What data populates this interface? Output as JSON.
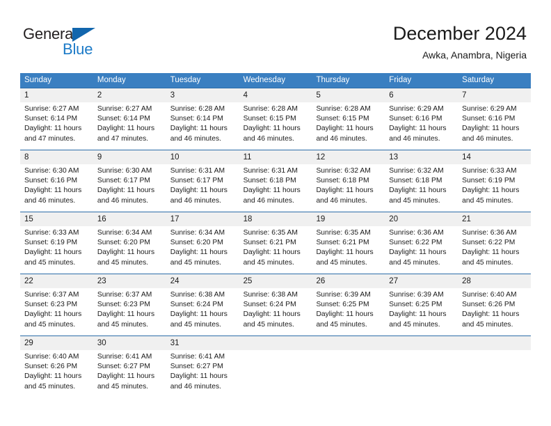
{
  "brand": {
    "name_part1": "General",
    "name_part2": "Blue",
    "accent_color": "#1b7ac7",
    "triangle_color": "#1266ad"
  },
  "header": {
    "title": "December 2024",
    "subtitle": "Awka, Anambra, Nigeria"
  },
  "theme": {
    "header_bg": "#3a7fc1",
    "row_divider": "#2b6ca8",
    "daynum_bg": "#f0f0f0"
  },
  "weekdays": [
    "Sunday",
    "Monday",
    "Tuesday",
    "Wednesday",
    "Thursday",
    "Friday",
    "Saturday"
  ],
  "weeks": [
    [
      {
        "day": "1",
        "sunrise": "Sunrise: 6:27 AM",
        "sunset": "Sunset: 6:14 PM",
        "daylight_line1": "Daylight: 11 hours",
        "daylight_line2": "and 47 minutes."
      },
      {
        "day": "2",
        "sunrise": "Sunrise: 6:27 AM",
        "sunset": "Sunset: 6:14 PM",
        "daylight_line1": "Daylight: 11 hours",
        "daylight_line2": "and 47 minutes."
      },
      {
        "day": "3",
        "sunrise": "Sunrise: 6:28 AM",
        "sunset": "Sunset: 6:14 PM",
        "daylight_line1": "Daylight: 11 hours",
        "daylight_line2": "and 46 minutes."
      },
      {
        "day": "4",
        "sunrise": "Sunrise: 6:28 AM",
        "sunset": "Sunset: 6:15 PM",
        "daylight_line1": "Daylight: 11 hours",
        "daylight_line2": "and 46 minutes."
      },
      {
        "day": "5",
        "sunrise": "Sunrise: 6:28 AM",
        "sunset": "Sunset: 6:15 PM",
        "daylight_line1": "Daylight: 11 hours",
        "daylight_line2": "and 46 minutes."
      },
      {
        "day": "6",
        "sunrise": "Sunrise: 6:29 AM",
        "sunset": "Sunset: 6:16 PM",
        "daylight_line1": "Daylight: 11 hours",
        "daylight_line2": "and 46 minutes."
      },
      {
        "day": "7",
        "sunrise": "Sunrise: 6:29 AM",
        "sunset": "Sunset: 6:16 PM",
        "daylight_line1": "Daylight: 11 hours",
        "daylight_line2": "and 46 minutes."
      }
    ],
    [
      {
        "day": "8",
        "sunrise": "Sunrise: 6:30 AM",
        "sunset": "Sunset: 6:16 PM",
        "daylight_line1": "Daylight: 11 hours",
        "daylight_line2": "and 46 minutes."
      },
      {
        "day": "9",
        "sunrise": "Sunrise: 6:30 AM",
        "sunset": "Sunset: 6:17 PM",
        "daylight_line1": "Daylight: 11 hours",
        "daylight_line2": "and 46 minutes."
      },
      {
        "day": "10",
        "sunrise": "Sunrise: 6:31 AM",
        "sunset": "Sunset: 6:17 PM",
        "daylight_line1": "Daylight: 11 hours",
        "daylight_line2": "and 46 minutes."
      },
      {
        "day": "11",
        "sunrise": "Sunrise: 6:31 AM",
        "sunset": "Sunset: 6:18 PM",
        "daylight_line1": "Daylight: 11 hours",
        "daylight_line2": "and 46 minutes."
      },
      {
        "day": "12",
        "sunrise": "Sunrise: 6:32 AM",
        "sunset": "Sunset: 6:18 PM",
        "daylight_line1": "Daylight: 11 hours",
        "daylight_line2": "and 46 minutes."
      },
      {
        "day": "13",
        "sunrise": "Sunrise: 6:32 AM",
        "sunset": "Sunset: 6:18 PM",
        "daylight_line1": "Daylight: 11 hours",
        "daylight_line2": "and 45 minutes."
      },
      {
        "day": "14",
        "sunrise": "Sunrise: 6:33 AM",
        "sunset": "Sunset: 6:19 PM",
        "daylight_line1": "Daylight: 11 hours",
        "daylight_line2": "and 45 minutes."
      }
    ],
    [
      {
        "day": "15",
        "sunrise": "Sunrise: 6:33 AM",
        "sunset": "Sunset: 6:19 PM",
        "daylight_line1": "Daylight: 11 hours",
        "daylight_line2": "and 45 minutes."
      },
      {
        "day": "16",
        "sunrise": "Sunrise: 6:34 AM",
        "sunset": "Sunset: 6:20 PM",
        "daylight_line1": "Daylight: 11 hours",
        "daylight_line2": "and 45 minutes."
      },
      {
        "day": "17",
        "sunrise": "Sunrise: 6:34 AM",
        "sunset": "Sunset: 6:20 PM",
        "daylight_line1": "Daylight: 11 hours",
        "daylight_line2": "and 45 minutes."
      },
      {
        "day": "18",
        "sunrise": "Sunrise: 6:35 AM",
        "sunset": "Sunset: 6:21 PM",
        "daylight_line1": "Daylight: 11 hours",
        "daylight_line2": "and 45 minutes."
      },
      {
        "day": "19",
        "sunrise": "Sunrise: 6:35 AM",
        "sunset": "Sunset: 6:21 PM",
        "daylight_line1": "Daylight: 11 hours",
        "daylight_line2": "and 45 minutes."
      },
      {
        "day": "20",
        "sunrise": "Sunrise: 6:36 AM",
        "sunset": "Sunset: 6:22 PM",
        "daylight_line1": "Daylight: 11 hours",
        "daylight_line2": "and 45 minutes."
      },
      {
        "day": "21",
        "sunrise": "Sunrise: 6:36 AM",
        "sunset": "Sunset: 6:22 PM",
        "daylight_line1": "Daylight: 11 hours",
        "daylight_line2": "and 45 minutes."
      }
    ],
    [
      {
        "day": "22",
        "sunrise": "Sunrise: 6:37 AM",
        "sunset": "Sunset: 6:23 PM",
        "daylight_line1": "Daylight: 11 hours",
        "daylight_line2": "and 45 minutes."
      },
      {
        "day": "23",
        "sunrise": "Sunrise: 6:37 AM",
        "sunset": "Sunset: 6:23 PM",
        "daylight_line1": "Daylight: 11 hours",
        "daylight_line2": "and 45 minutes."
      },
      {
        "day": "24",
        "sunrise": "Sunrise: 6:38 AM",
        "sunset": "Sunset: 6:24 PM",
        "daylight_line1": "Daylight: 11 hours",
        "daylight_line2": "and 45 minutes."
      },
      {
        "day": "25",
        "sunrise": "Sunrise: 6:38 AM",
        "sunset": "Sunset: 6:24 PM",
        "daylight_line1": "Daylight: 11 hours",
        "daylight_line2": "and 45 minutes."
      },
      {
        "day": "26",
        "sunrise": "Sunrise: 6:39 AM",
        "sunset": "Sunset: 6:25 PM",
        "daylight_line1": "Daylight: 11 hours",
        "daylight_line2": "and 45 minutes."
      },
      {
        "day": "27",
        "sunrise": "Sunrise: 6:39 AM",
        "sunset": "Sunset: 6:25 PM",
        "daylight_line1": "Daylight: 11 hours",
        "daylight_line2": "and 45 minutes."
      },
      {
        "day": "28",
        "sunrise": "Sunrise: 6:40 AM",
        "sunset": "Sunset: 6:26 PM",
        "daylight_line1": "Daylight: 11 hours",
        "daylight_line2": "and 45 minutes."
      }
    ],
    [
      {
        "day": "29",
        "sunrise": "Sunrise: 6:40 AM",
        "sunset": "Sunset: 6:26 PM",
        "daylight_line1": "Daylight: 11 hours",
        "daylight_line2": "and 45 minutes."
      },
      {
        "day": "30",
        "sunrise": "Sunrise: 6:41 AM",
        "sunset": "Sunset: 6:27 PM",
        "daylight_line1": "Daylight: 11 hours",
        "daylight_line2": "and 45 minutes."
      },
      {
        "day": "31",
        "sunrise": "Sunrise: 6:41 AM",
        "sunset": "Sunset: 6:27 PM",
        "daylight_line1": "Daylight: 11 hours",
        "daylight_line2": "and 46 minutes."
      },
      {
        "day": "",
        "sunrise": "",
        "sunset": "",
        "daylight_line1": "",
        "daylight_line2": ""
      },
      {
        "day": "",
        "sunrise": "",
        "sunset": "",
        "daylight_line1": "",
        "daylight_line2": ""
      },
      {
        "day": "",
        "sunrise": "",
        "sunset": "",
        "daylight_line1": "",
        "daylight_line2": ""
      },
      {
        "day": "",
        "sunrise": "",
        "sunset": "",
        "daylight_line1": "",
        "daylight_line2": ""
      }
    ]
  ]
}
